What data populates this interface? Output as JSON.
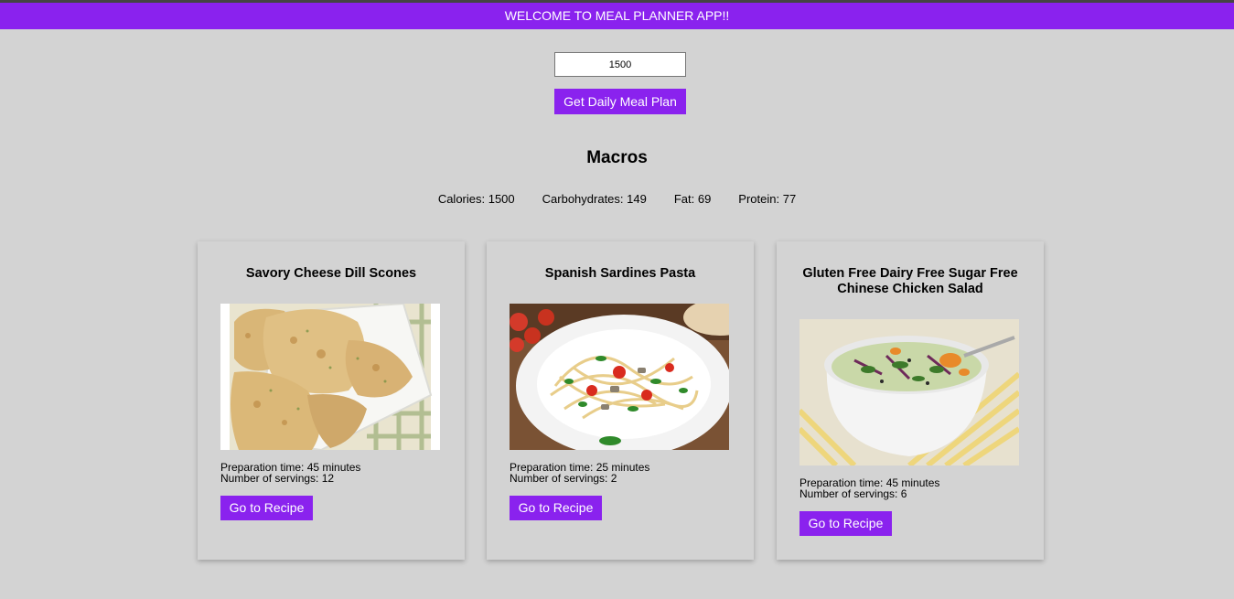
{
  "header": {
    "banner": "WELCOME TO MEAL PLANNER APP!!"
  },
  "form": {
    "calories_value": "1500",
    "submit_label": "Get Daily Meal Plan"
  },
  "macros": {
    "title": "Macros",
    "calories": "Calories: 1500",
    "carbohydrates": "Carbohydrates: 149",
    "fat": "Fat: 69",
    "protein": "Protein: 77"
  },
  "meals": [
    {
      "title": "Savory Cheese Dill Scones",
      "image": "scones-photo",
      "prep_time": "Preparation time: 45 minutes",
      "servings": "Number of servings: 12",
      "button": "Go to Recipe"
    },
    {
      "title": "Spanish Sardines Pasta",
      "image": "pasta-photo",
      "prep_time": "Preparation time: 25 minutes",
      "servings": "Number of servings: 2",
      "button": "Go to Recipe"
    },
    {
      "title": "Gluten Free Dairy Free Sugar Free Chinese Chicken Salad",
      "image": "salad-photo",
      "prep_time": "Preparation time: 45 minutes",
      "servings": "Number of servings: 6",
      "button": "Go to Recipe"
    }
  ],
  "colors": {
    "accent": "#8a22ee",
    "background": "#d3d3d3"
  }
}
